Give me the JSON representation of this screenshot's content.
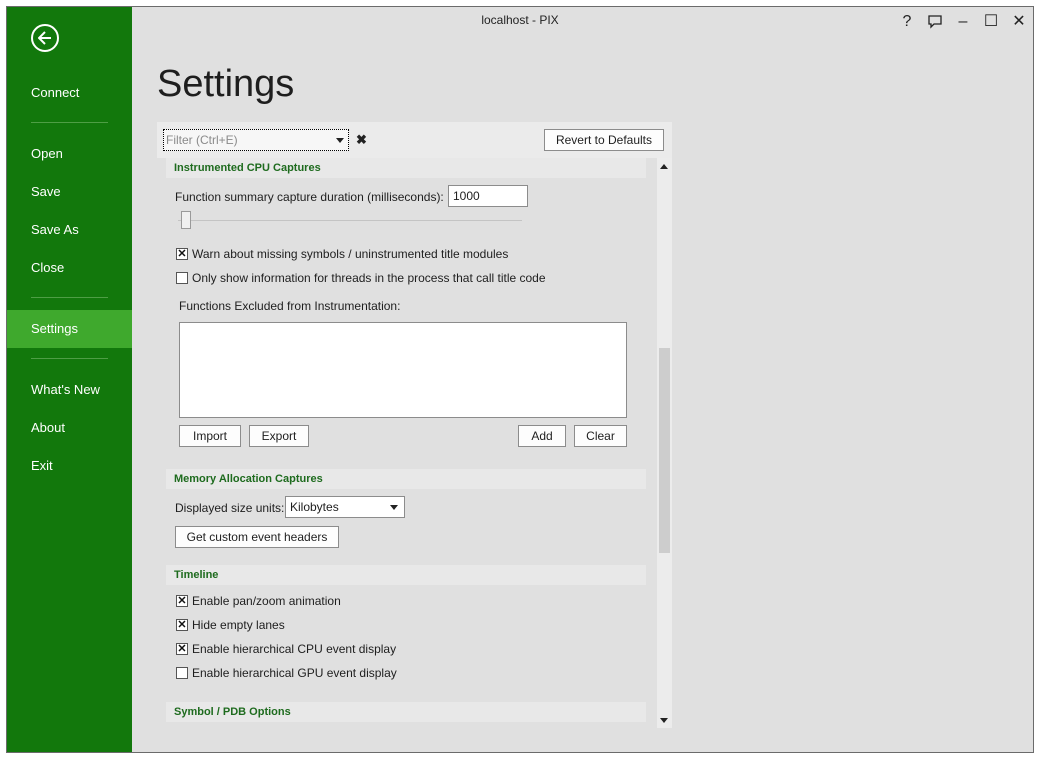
{
  "window": {
    "title": "localhost - PIX"
  },
  "title_bar": {
    "help": "?",
    "minimize": "–",
    "maximize": "☐",
    "close": "✕"
  },
  "sidebar": {
    "back_icon": "arrow-left-circle-icon",
    "items": [
      "Connect",
      "Open",
      "Save",
      "Save As",
      "Close",
      "Settings",
      "What's New",
      "About",
      "Exit"
    ],
    "active_item": "Settings"
  },
  "page": {
    "title": "Settings"
  },
  "toolbar": {
    "filter_placeholder": "Filter (Ctrl+E)",
    "clear_glyph": "✖",
    "revert_label": "Revert to Defaults"
  },
  "sections": {
    "cpu": {
      "title": "Instrumented CPU Captures",
      "duration_label": "Function summary capture duration (milliseconds):",
      "duration_value": "1000",
      "slider_fraction": 0.0,
      "warn_label": "Warn about missing symbols / uninstrumented title modules",
      "warn_checked": true,
      "only_threads_label": "Only show information for threads in the process that call title code",
      "only_threads_checked": false,
      "excluded_label": "Functions Excluded from Instrumentation:",
      "buttons": {
        "import": "Import",
        "export": "Export",
        "add": "Add",
        "clear": "Clear"
      }
    },
    "memory": {
      "title": "Memory Allocation Captures",
      "units_label": "Displayed size units:",
      "units_value": "Kilobytes",
      "headers_button": "Get custom event headers"
    },
    "timeline": {
      "title": "Timeline",
      "options": [
        {
          "label": "Enable pan/zoom animation",
          "checked": true
        },
        {
          "label": "Hide empty lanes",
          "checked": true
        },
        {
          "label": "Enable hierarchical CPU event display",
          "checked": true
        },
        {
          "label": "Enable hierarchical GPU event display",
          "checked": false
        }
      ]
    },
    "symbol": {
      "title": "Symbol / PDB Options"
    }
  },
  "colors": {
    "sidebar": "#12780c",
    "active": "#3fa92d",
    "section_text": "#1e6b1e"
  }
}
